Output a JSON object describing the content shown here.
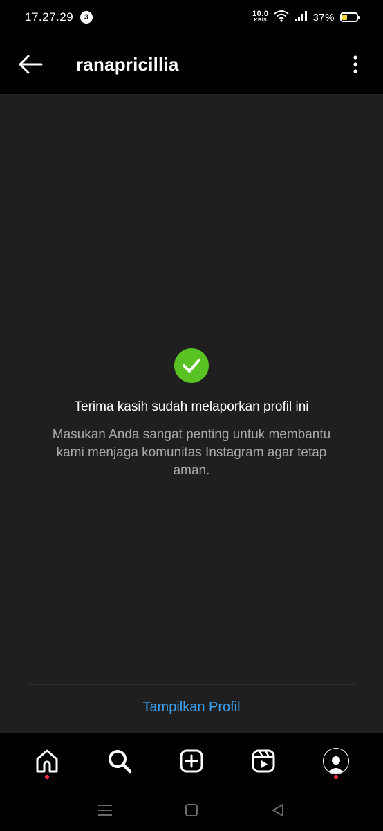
{
  "status_bar": {
    "time": "17.27.29",
    "notification_count": "3",
    "net_speed_value": "10.0",
    "net_speed_unit": "KB/S",
    "battery_percent": "37%"
  },
  "header": {
    "username": "ranapricillia"
  },
  "confirmation": {
    "title": "Terima kasih sudah melaporkan profil ini",
    "description": "Masukan Anda sangat penting untuk membantu kami menjaga komunitas Instagram agar tetap aman."
  },
  "actions": {
    "show_profile_label": "Tampilkan Profil"
  },
  "tab_bar": {
    "tabs": [
      {
        "name": "home",
        "icon": "home-icon",
        "has_dot": true
      },
      {
        "name": "search",
        "icon": "search-icon",
        "has_dot": false
      },
      {
        "name": "create",
        "icon": "add-post-icon",
        "has_dot": false
      },
      {
        "name": "reels",
        "icon": "reels-icon",
        "has_dot": false
      },
      {
        "name": "profile",
        "icon": "avatar",
        "has_dot": true
      }
    ]
  },
  "colors": {
    "background": "#000000",
    "panel": "#1f1f1f",
    "success_green": "#58c322",
    "link_blue": "#3aa0ef",
    "secondary_text": "#a8a8a8",
    "notification_dot": "#ff3040"
  }
}
